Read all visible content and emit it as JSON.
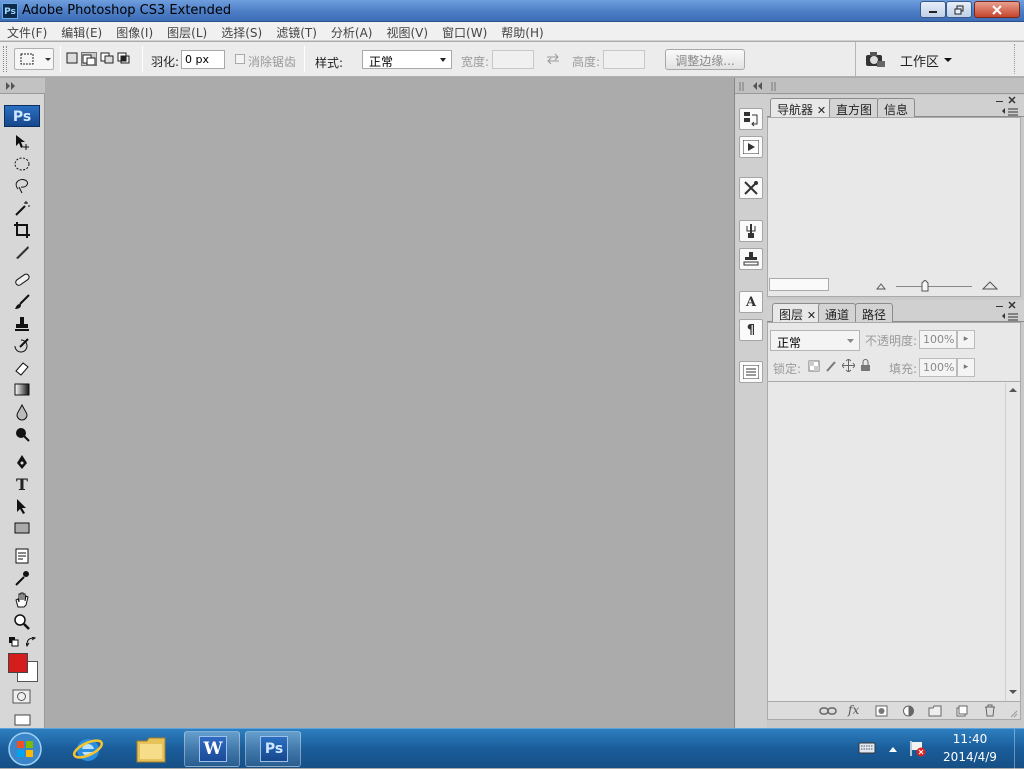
{
  "window": {
    "title": "Adobe Photoshop CS3 Extended",
    "ps_badge": "Ps"
  },
  "menu": [
    "文件(F)",
    "编辑(E)",
    "图像(I)",
    "图层(L)",
    "选择(S)",
    "滤镜(T)",
    "分析(A)",
    "视图(V)",
    "窗口(W)",
    "帮助(H)"
  ],
  "options": {
    "feather_label": "羽化:",
    "feather_value": "0 px",
    "antialias_label": "消除锯齿",
    "style_label": "样式:",
    "style_value": "正常",
    "width_label": "宽度:",
    "height_label": "高度:",
    "refine_edge_button": "调整边缘...",
    "workspace_label": "工作区"
  },
  "toolbox": {
    "ps_logo": "Ps",
    "tools": [
      "move-tool-icon",
      "marquee-tool-icon",
      "lasso-tool-icon",
      "magic-wand-tool-icon",
      "crop-tool-icon",
      "slice-tool-icon",
      "healing-brush-tool-icon",
      "brush-tool-icon",
      "clone-stamp-tool-icon",
      "history-brush-tool-icon",
      "eraser-tool-icon",
      "gradient-tool-icon",
      "blur-tool-icon",
      "dodge-tool-icon",
      "pen-tool-icon",
      "type-tool-icon",
      "path-selection-tool-icon",
      "rectangle-tool-icon",
      "notes-tool-icon",
      "eyedropper-tool-icon",
      "hand-tool-icon",
      "zoom-tool-icon"
    ],
    "type_glyph": "T",
    "foreground_color": "#d41d1d",
    "background_color": "#ffffff"
  },
  "dock": {
    "char_icon": "A",
    "paragraph_icon": "¶"
  },
  "navigator_panel": {
    "tabs": [
      "导航器",
      "直方图",
      "信息"
    ]
  },
  "layers_panel": {
    "tabs": [
      "图层",
      "通道",
      "路径"
    ],
    "blend_mode": "正常",
    "opacity_label": "不透明度:",
    "opacity_value": "100%",
    "lock_label": "锁定:",
    "fill_label": "填充:",
    "fill_value": "100%",
    "fx_label": "fx"
  },
  "taskbar": {
    "time": "11:40",
    "date": "2014/4/9",
    "ps_button": "Ps",
    "word_button": "W"
  }
}
